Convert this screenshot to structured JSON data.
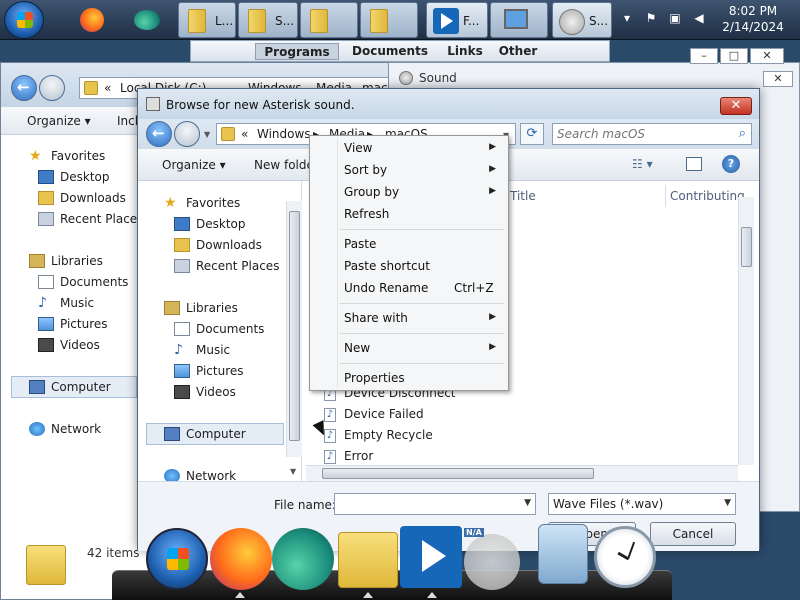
{
  "taskbar": {
    "buttons": [
      {
        "label": "L..."
      },
      {
        "label": "S..."
      },
      {
        "label": "F..."
      },
      {
        "label": "S..."
      }
    ],
    "clock_time": "8:02 PM",
    "clock_date": "2/14/2024"
  },
  "jumpbar": {
    "tabs": [
      "Programs",
      "Documents",
      "Links",
      "Other"
    ],
    "selected": "Programs"
  },
  "bg_explorer": {
    "address": [
      "«",
      "Local Disk (C:)",
      "▸",
      "Windows",
      "▸",
      "Media",
      "▸",
      "macOS"
    ],
    "organize": "Organize",
    "include": "Inclu",
    "nav": {
      "favorites": "Favorites",
      "desktop": "Desktop",
      "downloads": "Downloads",
      "recent": "Recent Places",
      "libraries": "Libraries",
      "documents": "Documents",
      "music": "Music",
      "pictures": "Pictures",
      "videos": "Videos",
      "computer": "Computer",
      "network": "Network"
    },
    "status": "42 items"
  },
  "sound_dialog": {
    "title": "Sound"
  },
  "dialog": {
    "title": "Browse for new Asterisk sound.",
    "address": {
      "prefix": "«",
      "segments": [
        "Windows",
        "Media",
        "macOS"
      ]
    },
    "search_placeholder": "Search macOS",
    "organize": "Organize",
    "new_folder": "New folder",
    "nav": {
      "favorites": "Favorites",
      "desktop": "Desktop",
      "downloads": "Downloads",
      "recent": "Recent Places",
      "libraries": "Libraries",
      "documents": "Documents",
      "music": "Music",
      "pictures": "Pictures",
      "videos": "Videos",
      "computer": "Computer",
      "network": "Network"
    },
    "columns": {
      "title": "Title",
      "contributing": "Contributing"
    },
    "files": [
      "Device Disconnect",
      "Device Failed",
      "Empty Recycle",
      "Error"
    ],
    "file_name_label": "File name:",
    "file_name_value": "",
    "file_type": "Wave Files (*.wav)",
    "open_button": "Open",
    "cancel_button": "Cancel"
  },
  "context_menu": {
    "items": [
      {
        "label": "View",
        "submenu": true
      },
      {
        "label": "Sort by",
        "submenu": true
      },
      {
        "label": "Group by",
        "submenu": true
      },
      {
        "label": "Refresh"
      },
      {
        "label": "Paste"
      },
      {
        "label": "Paste shortcut"
      },
      {
        "label": "Undo Rename",
        "shortcut": "Ctrl+Z"
      },
      {
        "label": "Share with",
        "submenu": true
      },
      {
        "label": "New",
        "submenu": true
      },
      {
        "label": "Properties"
      }
    ]
  },
  "dock": {
    "na_label": "N/A"
  }
}
